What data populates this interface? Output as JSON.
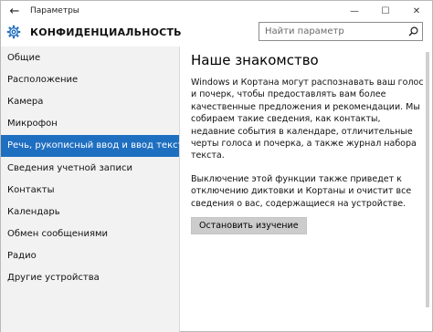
{
  "window": {
    "title": "Параметры",
    "controls": {
      "minimize": "—",
      "maximize": "☐",
      "close": "✕"
    }
  },
  "header": {
    "title": "КОНФИДЕНЦИАЛЬНОСТЬ",
    "search_placeholder": "Найти параметр"
  },
  "sidebar": {
    "items": [
      {
        "label": "Общие"
      },
      {
        "label": "Расположение"
      },
      {
        "label": "Камера"
      },
      {
        "label": "Микрофон"
      },
      {
        "label": "Речь, рукописный ввод и ввод текста",
        "active": true
      },
      {
        "label": "Сведения учетной записи"
      },
      {
        "label": "Контакты"
      },
      {
        "label": "Календарь"
      },
      {
        "label": "Обмен сообщениями"
      },
      {
        "label": "Радио"
      },
      {
        "label": "Другие устройства"
      }
    ]
  },
  "main": {
    "heading": "Наше знакомство",
    "paragraph1": "Windows и Кортана могут распознавать ваш голос и почерк, чтобы предоставлять вам более качественные предложения и рекомендации. Мы собираем такие сведения, как контакты, недавние события в календаре, отличительные черты голоса и почерка, а также журнал набора текста.",
    "paragraph2": "Выключение этой функции также приведет к отключению диктовки и Кортаны и очистит все сведения о вас, содержащиеся на устройстве.",
    "button_label": "Остановить изучение"
  },
  "colors": {
    "accent": "#1f6fc1",
    "sidebar_bg": "#f2f2f2",
    "button_bg": "#cccccc"
  }
}
